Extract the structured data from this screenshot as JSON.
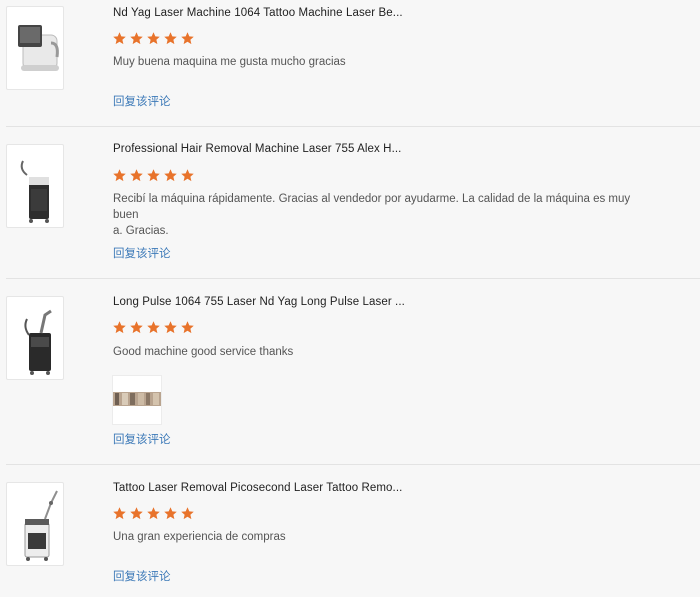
{
  "reviews": [
    {
      "title": "Nd Yag Laser Machine 1064 Tattoo Machine Laser Be...",
      "rating": 5,
      "comment": "Muy buena maquina me gusta mucho gracias",
      "reply": "回复该评论",
      "product_icon": "tabletop-laser-machine-icon"
    },
    {
      "title": "Professional Hair Removal Machine Laser 755 Alex H...",
      "rating": 5,
      "comment_line1": "Recibí la máquina rápidamente. Gracias al vendedor por ayudarme. La calidad de la máquina es muy buen",
      "comment_line2": "a. Gracias.",
      "reply": "回复该评论",
      "product_icon": "standing-laser-machine-icon"
    },
    {
      "title": "Long Pulse 1064 755 Laser Nd Yag Long Pulse Laser ...",
      "rating": 5,
      "comment": "Good machine good service thanks",
      "reply": "回复该评论",
      "product_icon": "tall-arm-laser-machine-icon",
      "photo_icon": "review-photo-icon"
    },
    {
      "title": "Tattoo Laser Removal Picosecond Laser Tattoo Remo...",
      "rating": 5,
      "comment": "Una gran experiencia de compras",
      "reply": "回复该评论",
      "product_icon": "articulated-arm-laser-machine-icon"
    }
  ],
  "colors": {
    "star": "#e8732b",
    "reply_link": "#3d7ab8",
    "divider": "#e3e3e3"
  }
}
